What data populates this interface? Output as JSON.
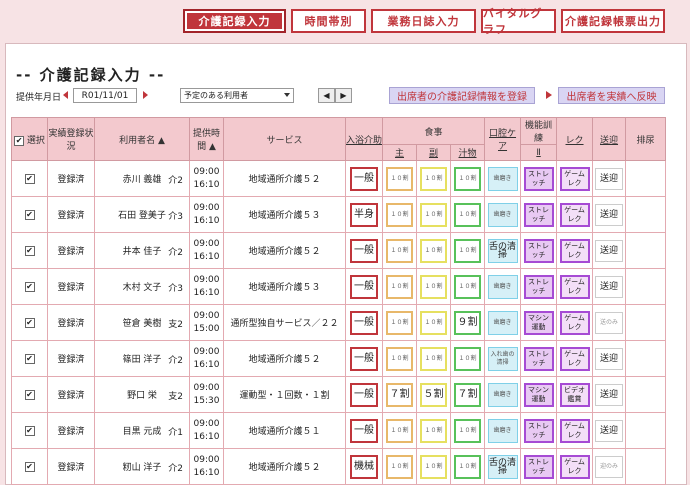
{
  "tabs": [
    "介護記録入力",
    "時間帯別",
    "業務日誌入力",
    "バイタルグラフ",
    "介護記録帳票出力"
  ],
  "page_title": "-- 介護記録入力 --",
  "date_label": "提供年月日",
  "date_value": "R01/11/01",
  "select_value": "予定のある利用者",
  "pager_prev": "◀",
  "pager_next": "▶",
  "btn_register": "出席者の介護記録情報を登録",
  "btn_reflect": "出席者を実績へ反映",
  "headers": {
    "select": "選択",
    "status": "実績登録状況",
    "name": "利用者名 ▲",
    "time": "提供時間",
    "time_sort": "▲",
    "service": "サービス",
    "bath": "入浴介助",
    "meal": "食事",
    "meal_main": "主",
    "meal_side": "副",
    "meal_soup": "汁物",
    "oral": "口腔ケア",
    "func": "機能訓練",
    "func_sub": "Ⅱ",
    "rec": "レク",
    "trans": "送迎",
    "excretion": "排尿"
  },
  "rows": [
    {
      "check": "✔",
      "status": "登録済",
      "name": "赤川 義雄",
      "lvl": "介2",
      "t1": "09:00",
      "t2": "16:10",
      "svc": "地域通所介護５２",
      "bath": "一般",
      "main": "１０割",
      "side": "１０割",
      "soup": "１０割",
      "oral": "歯磨き",
      "fn1": "ストレ",
      "fn2": "ッチ",
      "rc1": "ゲーム",
      "rc2": "レク",
      "trn": "送迎"
    },
    {
      "check": "✔",
      "status": "登録済",
      "name": "石田 登美子",
      "lvl": "介3",
      "t1": "09:00",
      "t2": "16:10",
      "svc": "地域通所介護５３",
      "bath": "半身",
      "main": "１０割",
      "side": "１０割",
      "soup": "１０割",
      "oral": "歯磨き",
      "fn1": "ストレ",
      "fn2": "ッチ",
      "rc1": "ゲーム",
      "rc2": "レク",
      "trn": "送迎"
    },
    {
      "check": "✔",
      "status": "登録済",
      "name": "井本 佳子",
      "lvl": "介2",
      "t1": "09:00",
      "t2": "16:10",
      "svc": "地域通所介護５２",
      "bath": "一般",
      "main": "１０割",
      "side": "１０割",
      "soup": "１０割",
      "oral": "舌の清掃",
      "fn1": "ストレ",
      "fn2": "ッチ",
      "rc1": "ゲーム",
      "rc2": "レク",
      "trn": "送迎"
    },
    {
      "check": "✔",
      "status": "登録済",
      "name": "木村 文子",
      "lvl": "介3",
      "t1": "09:00",
      "t2": "16:10",
      "svc": "地域通所介護５３",
      "bath": "一般",
      "main": "１０割",
      "side": "１０割",
      "soup": "１０割",
      "oral": "歯磨き",
      "fn1": "ストレ",
      "fn2": "ッチ",
      "rc1": "ゲーム",
      "rc2": "レク",
      "trn": "送迎"
    },
    {
      "check": "✔",
      "status": "登録済",
      "name": "笹倉 美樹",
      "lvl": "支2",
      "t1": "09:00",
      "t2": "15:00",
      "svc": "通所型独自サービス／２２",
      "bath": "一般",
      "main": "１０割",
      "side": "１０割",
      "soup": "９割",
      "oral": "歯磨き",
      "fn1": "マシン",
      "fn2": "運動",
      "rc1": "ゲーム",
      "rc2": "レク",
      "trn": "送のみ"
    },
    {
      "check": "✔",
      "status": "登録済",
      "name": "篠田 洋子",
      "lvl": "介2",
      "t1": "09:00",
      "t2": "16:10",
      "svc": "地域通所介護５２",
      "bath": "一般",
      "main": "１０割",
      "side": "１０割",
      "soup": "１０割",
      "oral": "入れ歯の清掃",
      "fn1": "ストレ",
      "fn2": "ッチ",
      "rc1": "ゲーム",
      "rc2": "レク",
      "trn": "送迎"
    },
    {
      "check": "✔",
      "status": "登録済",
      "name": "野口 栄",
      "lvl": "支2",
      "t1": "09:00",
      "t2": "15:30",
      "svc": "運動型・１回数・１割",
      "bath": "一般",
      "main": "７割",
      "side": "５割",
      "soup": "７割",
      "oral": "歯磨き",
      "fn1": "マシン",
      "fn2": "運動",
      "rc1": "ビデオ",
      "rc2": "鑑賞",
      "trn": "送迎"
    },
    {
      "check": "✔",
      "status": "登録済",
      "name": "目黒 元成",
      "lvl": "介1",
      "t1": "09:00",
      "t2": "16:10",
      "svc": "地域通所介護５１",
      "bath": "一般",
      "main": "１０割",
      "side": "１０割",
      "soup": "１０割",
      "oral": "歯磨き",
      "fn1": "ストレ",
      "fn2": "ッチ",
      "rc1": "ゲーム",
      "rc2": "レク",
      "trn": "送迎"
    },
    {
      "check": "✔",
      "status": "登録済",
      "name": "籾山 洋子",
      "lvl": "介2",
      "t1": "09:00",
      "t2": "16:10",
      "svc": "地域通所介護５２",
      "bath": "機械",
      "main": "１０割",
      "side": "１０割",
      "soup": "１０割",
      "oral": "舌の清掃",
      "fn1": "ストレ",
      "fn2": "ッチ",
      "rc1": "ゲーム",
      "rc2": "レク",
      "trn": "迎のみ"
    }
  ]
}
